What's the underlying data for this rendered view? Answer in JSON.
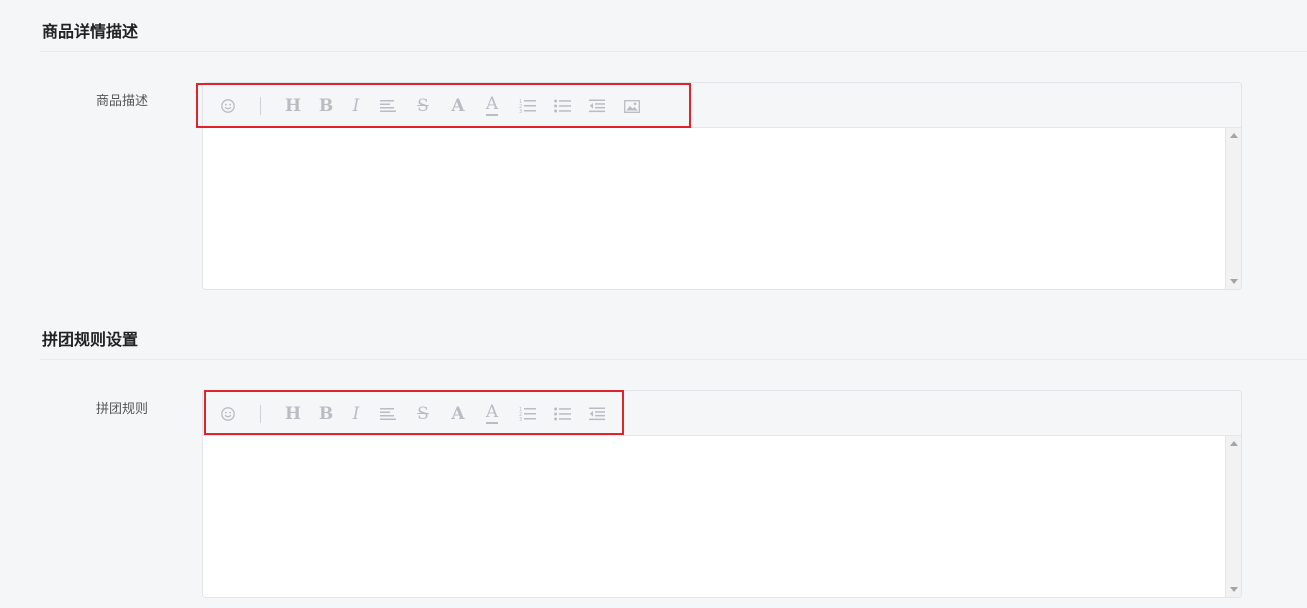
{
  "sections": [
    {
      "title": "商品详情描述",
      "field_label": "商品描述"
    },
    {
      "title": "拼团规则设置",
      "field_label": "拼团规则"
    }
  ],
  "toolbar_icons": {
    "emoji": "smiley-icon",
    "heading": "H",
    "bold": "B",
    "italic": "I",
    "align": "align-left-icon",
    "strike": "S",
    "font_size": "A",
    "font_color": "A",
    "ordered_list": "ordered-list-icon",
    "unordered_list": "unordered-list-icon",
    "indent": "indent-icon",
    "image": "image-icon"
  },
  "colors": {
    "highlight": "#e0242c",
    "icon": "#b9bcc3",
    "background": "#f5f6f8"
  }
}
